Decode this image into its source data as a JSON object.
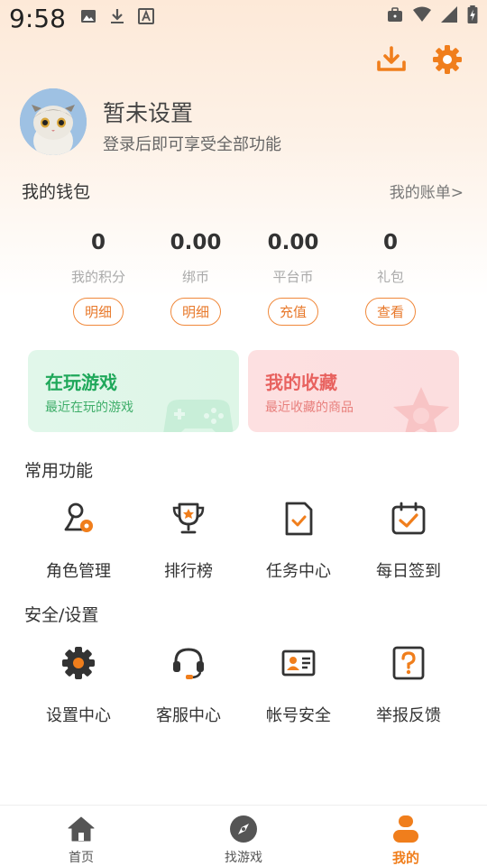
{
  "status_bar": {
    "time": "9:58",
    "icons_left": [
      "image-icon",
      "download-icon",
      "text-icon"
    ],
    "icons_right": [
      "briefcase-icon",
      "wifi-icon",
      "signal-icon",
      "battery-icon"
    ]
  },
  "top_actions": [
    "download-icon",
    "gear-icon"
  ],
  "profile": {
    "name": "暂未设置",
    "subtitle": "登录后即可享受全部功能"
  },
  "wallet": {
    "title": "我的钱包",
    "bill_link": "我的账单>",
    "items": [
      {
        "value": "0",
        "label": "我的积分",
        "button": "明细"
      },
      {
        "value": "0.00",
        "label": "绑币",
        "button": "明细"
      },
      {
        "value": "0.00",
        "label": "平台币",
        "button": "充值"
      },
      {
        "value": "0",
        "label": "礼包",
        "button": "查看"
      }
    ]
  },
  "cards": {
    "playing": {
      "title": "在玩游戏",
      "subtitle": "最近在玩的游戏"
    },
    "favorites": {
      "title": "我的收藏",
      "subtitle": "最近收藏的商品"
    }
  },
  "common_functions": {
    "title": "常用功能",
    "items": [
      {
        "label": "角色管理",
        "icon": "role-settings-icon"
      },
      {
        "label": "排行榜",
        "icon": "trophy-icon"
      },
      {
        "label": "任务中心",
        "icon": "task-icon"
      },
      {
        "label": "每日签到",
        "icon": "checkin-icon"
      }
    ]
  },
  "security_settings": {
    "title": "安全/设置",
    "items": [
      {
        "label": "设置中心",
        "icon": "gear-icon"
      },
      {
        "label": "客服中心",
        "icon": "headset-icon"
      },
      {
        "label": "帐号安全",
        "icon": "id-card-icon"
      },
      {
        "label": "举报反馈",
        "icon": "question-icon"
      }
    ]
  },
  "bottom_nav": [
    {
      "label": "首页",
      "icon": "home-icon",
      "active": false
    },
    {
      "label": "找游戏",
      "icon": "compass-icon",
      "active": false
    },
    {
      "label": "我的",
      "icon": "user-icon",
      "active": true
    }
  ],
  "colors": {
    "accent": "#f07e1c",
    "green": "#1fa85a",
    "red": "#e8625f"
  }
}
